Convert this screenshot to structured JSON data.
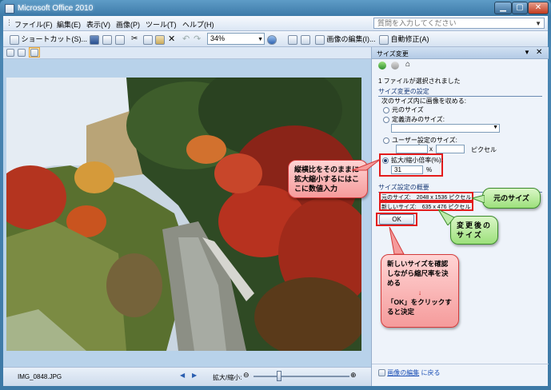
{
  "window": {
    "title": "Microsoft Office 2010"
  },
  "menubar": {
    "items": [
      "ファイル(F)",
      "編集(E)",
      "表示(V)",
      "画像(P)",
      "ツール(T)",
      "ヘルプ(H)"
    ],
    "help_placeholder": "質問を入力してください"
  },
  "toolbar": {
    "shortcut_label": "ショートカット(S)...",
    "zoom_value": "34%",
    "edit_picture_label": "画像の編集(I)...",
    "auto_correct_label": "自動修正(A)"
  },
  "status": {
    "filename": "IMG_0848.JPG",
    "zoom_label": "拡大/縮小:"
  },
  "pane": {
    "title": "サイズ変更",
    "files_selected": "1 ファイルが選択されました",
    "section_settings": "サイズ変更の設定",
    "resize_instruction": "次のサイズ内に画像を収める:",
    "radio_original": "元のサイズ",
    "radio_predefined": "定義済みのサイズ:",
    "radio_custom": "ユーザー設定のサイズ:",
    "custom_x": "x",
    "custom_unit": "ピクセル",
    "radio_percent": "拡大/縮小倍率(%):",
    "percent_value": "31",
    "percent_unit": "%",
    "section_summary": "サイズ設定の概要",
    "original_size": "元のサイズ:　2048 x 1536 ピクセル",
    "new_size": "新しいサイズ:　635 x 476 ピクセル",
    "ok_label": "OK",
    "footer_link": "画像の編集",
    "footer_suffix": "に戻る"
  },
  "callouts": {
    "ratio_note": "縦横比をそのままに拡大縮小するにはここに数値入力",
    "original_note": "元のサイズ",
    "new_note": "変更後のサイズ",
    "instruction_line1": "新しいサイズを確認しながら縮尺率を決める",
    "instruction_arrow": "↓",
    "instruction_line2": "「OK」をクリックすると決定"
  },
  "colors": {
    "highlight": "#e31b1b",
    "callout_pink": "#f59b9b",
    "callout_green": "#9ce07b"
  }
}
